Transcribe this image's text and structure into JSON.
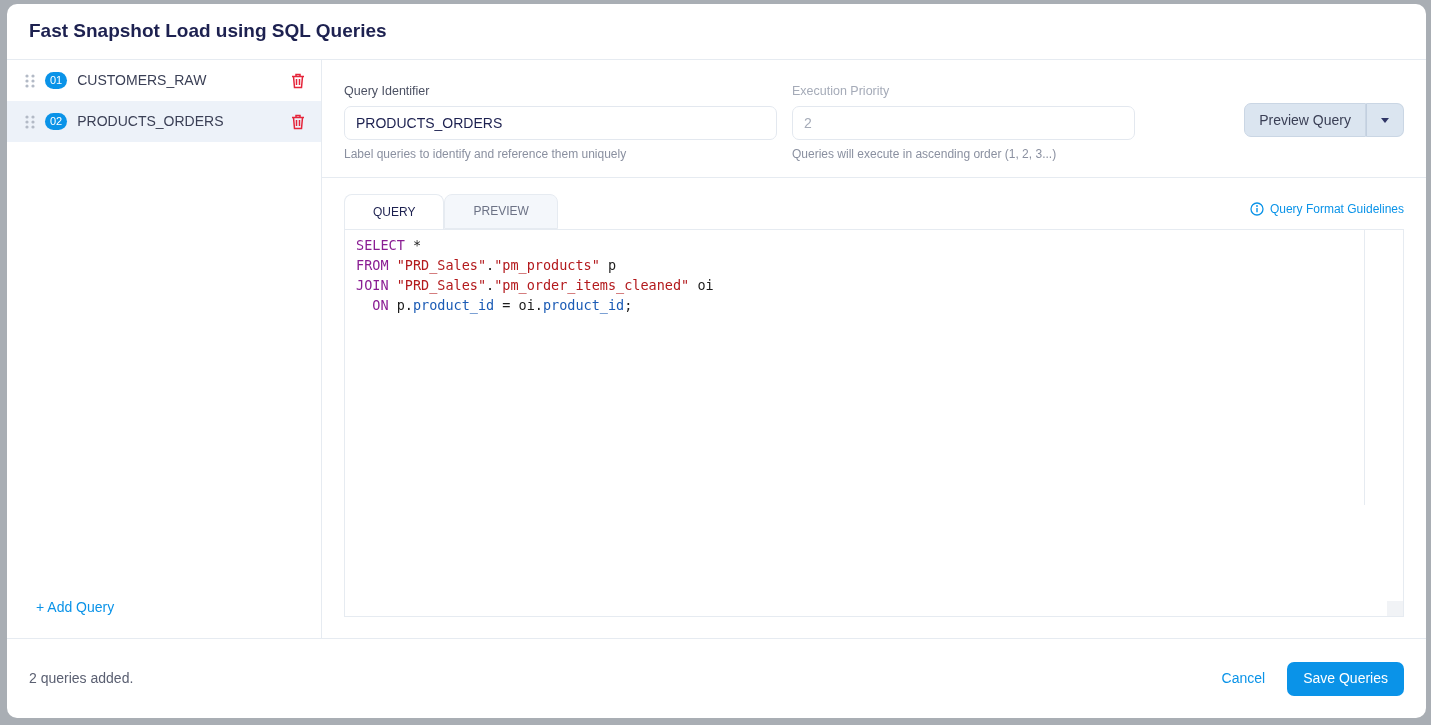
{
  "dialog": {
    "title": "Fast Snapshot Load using SQL Queries"
  },
  "queries": [
    {
      "number": "01",
      "name": "CUSTOMERS_RAW",
      "selected": false
    },
    {
      "number": "02",
      "name": "PRODUCTS_ORDERS",
      "selected": true
    }
  ],
  "add_query": "+ Add Query",
  "form": {
    "identifier": {
      "label": "Query Identifier",
      "value": "PRODUCTS_ORDERS",
      "help": "Label queries to identify and reference them uniquely",
      "disabled": false
    },
    "priority": {
      "label": "Execution Priority",
      "value": "2",
      "help": "Queries will execute in ascending order (1, 2, 3...)",
      "disabled": true
    },
    "preview_button": "Preview Query"
  },
  "tabs": [
    {
      "label": "QUERY",
      "selected": true
    },
    {
      "label": "PREVIEW",
      "selected": false
    }
  ],
  "guidelines_link": "Query Format Guidelines",
  "code_lines": [
    [
      {
        "kind": "keyword",
        "text": "SELECT"
      },
      {
        "kind": "plain",
        "text": " *"
      }
    ],
    [
      {
        "kind": "keyword",
        "text": "FROM"
      },
      {
        "kind": "string",
        "text": "\"PRD_Sales\"",
        "gap": true
      },
      {
        "kind": "plain",
        "text": "."
      },
      {
        "kind": "string",
        "text": "\"pm_products\""
      },
      {
        "kind": "plain",
        "text": " p"
      }
    ],
    [
      {
        "kind": "keyword",
        "text": "JOIN"
      },
      {
        "kind": "string",
        "text": "\"PRD_Sales\"",
        "gap": true
      },
      {
        "kind": "plain",
        "text": "."
      },
      {
        "kind": "string",
        "text": "\"pm_order_items_cleaned\""
      },
      {
        "kind": "plain",
        "text": " oi"
      }
    ],
    [
      {
        "kind": "keyword",
        "text": "ON",
        "indent": true
      },
      {
        "kind": "plain",
        "text": " p."
      },
      {
        "kind": "field",
        "text": "product_id"
      },
      {
        "kind": "plain",
        "text": " = oi."
      },
      {
        "kind": "field",
        "text": "product_id"
      },
      {
        "kind": "plain",
        "text": ";"
      }
    ]
  ],
  "footer": {
    "status": "2 queries added.",
    "cancel": "Cancel",
    "save": "Save Queries"
  }
}
